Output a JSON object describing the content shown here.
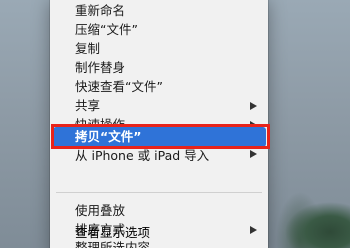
{
  "menu": {
    "items": [
      {
        "label": "重新命名"
      },
      {
        "label": "压缩“文件”"
      },
      {
        "label": "复制"
      },
      {
        "label": "制作替身"
      },
      {
        "label": "快速查看“文件”"
      },
      {
        "label": "共享"
      },
      {
        "label": "快速操作"
      }
    ],
    "selected": {
      "label": "拷贝“文件”"
    },
    "continuity": {
      "label": "从 iPhone 或 iPad 导入"
    },
    "view_items": [
      {
        "label": "使用叠放"
      },
      {
        "label": "排序方式"
      },
      {
        "label": "整理所选内容"
      },
      {
        "label": "查看显示选项"
      }
    ]
  },
  "colors": {
    "highlight": "#2f73d8",
    "annotation_box": "#e8241b",
    "menu_background": "#f1f1f1"
  }
}
